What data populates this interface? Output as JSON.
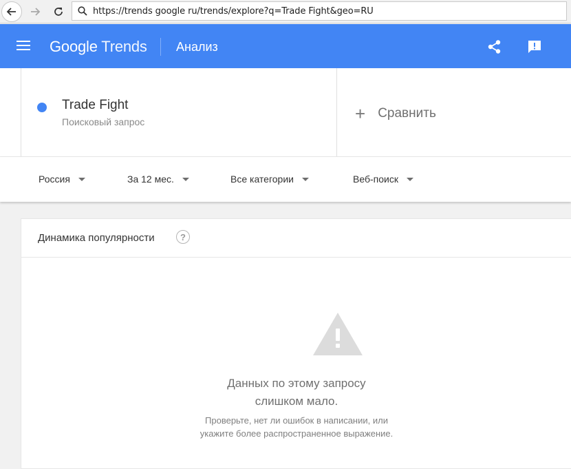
{
  "browser": {
    "url": "https://trends google ru/trends/explore?q=Trade Fight&geo=RU"
  },
  "header": {
    "logo_google": "Google",
    "logo_trends": "Trends",
    "title": "Анализ"
  },
  "term": {
    "name": "Trade Fight",
    "type": "Поисковый запрос",
    "color": "#4285f4"
  },
  "compare": {
    "plus": "+",
    "label": "Сравнить"
  },
  "filters": {
    "region": "Россия",
    "period": "За 12 мес.",
    "category": "Все категории",
    "search_type": "Веб-поиск"
  },
  "interest": {
    "title": "Динамика популярности",
    "help": "?",
    "message_line1": "Данных по этому запросу",
    "message_line2": "слишком мало.",
    "hint_line1": "Проверьте, нет ли ошибок в написании, или",
    "hint_line2": "укажите более распространенное выражение."
  },
  "colors": {
    "brand_blue": "#4285f4"
  }
}
